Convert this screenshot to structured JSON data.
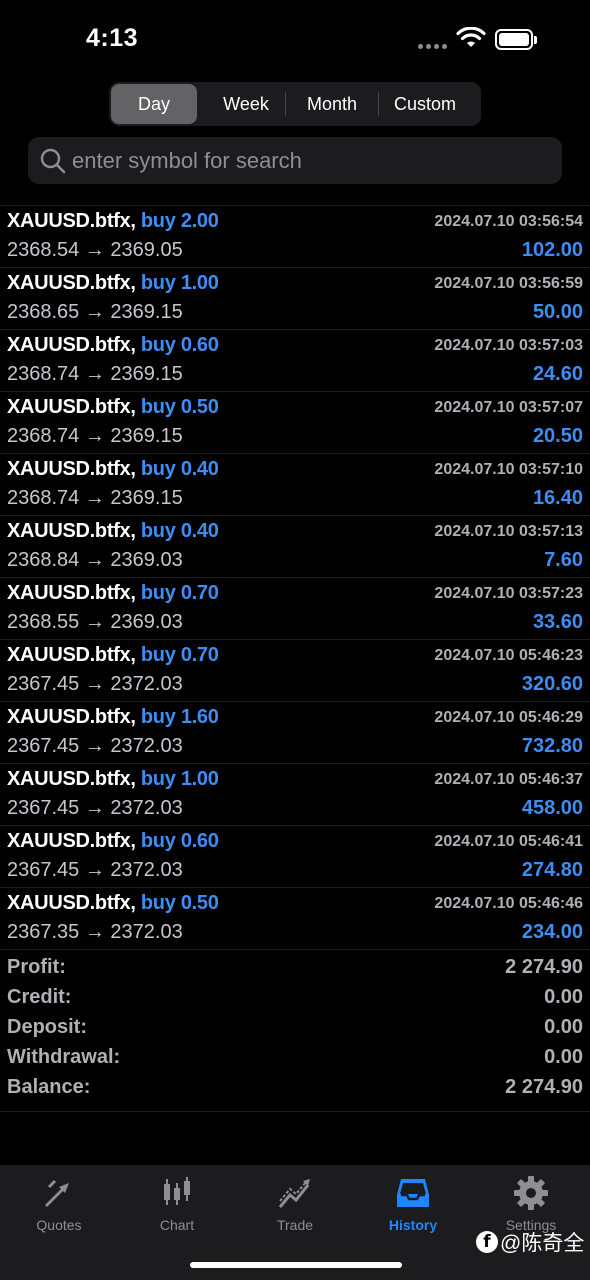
{
  "status_bar": {
    "time": "4:13"
  },
  "period_tabs": [
    {
      "label": "Day",
      "active": true
    },
    {
      "label": "Week",
      "active": false
    },
    {
      "label": "Month",
      "active": false
    },
    {
      "label": "Custom",
      "active": false
    }
  ],
  "search": {
    "placeholder": "enter symbol for search",
    "value": ""
  },
  "deals": [
    {
      "symbol": "XAUUSD.btfx",
      "side": "buy",
      "volume": "2.00",
      "time": "2024.07.10 03:56:54",
      "open": "2368.54",
      "close": "2369.05",
      "profit": "102.00"
    },
    {
      "symbol": "XAUUSD.btfx",
      "side": "buy",
      "volume": "1.00",
      "time": "2024.07.10 03:56:59",
      "open": "2368.65",
      "close": "2369.15",
      "profit": "50.00"
    },
    {
      "symbol": "XAUUSD.btfx",
      "side": "buy",
      "volume": "0.60",
      "time": "2024.07.10 03:57:03",
      "open": "2368.74",
      "close": "2369.15",
      "profit": "24.60"
    },
    {
      "symbol": "XAUUSD.btfx",
      "side": "buy",
      "volume": "0.50",
      "time": "2024.07.10 03:57:07",
      "open": "2368.74",
      "close": "2369.15",
      "profit": "20.50"
    },
    {
      "symbol": "XAUUSD.btfx",
      "side": "buy",
      "volume": "0.40",
      "time": "2024.07.10 03:57:10",
      "open": "2368.74",
      "close": "2369.15",
      "profit": "16.40"
    },
    {
      "symbol": "XAUUSD.btfx",
      "side": "buy",
      "volume": "0.40",
      "time": "2024.07.10 03:57:13",
      "open": "2368.84",
      "close": "2369.03",
      "profit": "7.60"
    },
    {
      "symbol": "XAUUSD.btfx",
      "side": "buy",
      "volume": "0.70",
      "time": "2024.07.10 03:57:23",
      "open": "2368.55",
      "close": "2369.03",
      "profit": "33.60"
    },
    {
      "symbol": "XAUUSD.btfx",
      "side": "buy",
      "volume": "0.70",
      "time": "2024.07.10 05:46:23",
      "open": "2367.45",
      "close": "2372.03",
      "profit": "320.60"
    },
    {
      "symbol": "XAUUSD.btfx",
      "side": "buy",
      "volume": "1.60",
      "time": "2024.07.10 05:46:29",
      "open": "2367.45",
      "close": "2372.03",
      "profit": "732.80"
    },
    {
      "symbol": "XAUUSD.btfx",
      "side": "buy",
      "volume": "1.00",
      "time": "2024.07.10 05:46:37",
      "open": "2367.45",
      "close": "2372.03",
      "profit": "458.00"
    },
    {
      "symbol": "XAUUSD.btfx",
      "side": "buy",
      "volume": "0.60",
      "time": "2024.07.10 05:46:41",
      "open": "2367.45",
      "close": "2372.03",
      "profit": "274.80"
    },
    {
      "symbol": "XAUUSD.btfx",
      "side": "buy",
      "volume": "0.50",
      "time": "2024.07.10 05:46:46",
      "open": "2367.35",
      "close": "2372.03",
      "profit": "234.00"
    }
  ],
  "summary": [
    {
      "label": "Profit:",
      "value": "2 274.90"
    },
    {
      "label": "Credit:",
      "value": "0.00"
    },
    {
      "label": "Deposit:",
      "value": "0.00"
    },
    {
      "label": "Withdrawal:",
      "value": "0.00"
    },
    {
      "label": "Balance:",
      "value": "2 274.90"
    }
  ],
  "tabbar": [
    {
      "label": "Quotes",
      "icon": "quotes-icon",
      "active": false
    },
    {
      "label": "Chart",
      "icon": "chart-icon",
      "active": false
    },
    {
      "label": "Trade",
      "icon": "trade-icon",
      "active": false
    },
    {
      "label": "History",
      "icon": "history-icon",
      "active": true
    },
    {
      "label": "Settings",
      "icon": "gear-icon",
      "active": false
    }
  ],
  "watermark": {
    "text": "@陈奇全",
    "icon": "facebook-icon"
  },
  "colors": {
    "accent": "#1e87ff",
    "buy": "#3d8df5",
    "background": "#000000",
    "surface": "#1c1c1e"
  }
}
